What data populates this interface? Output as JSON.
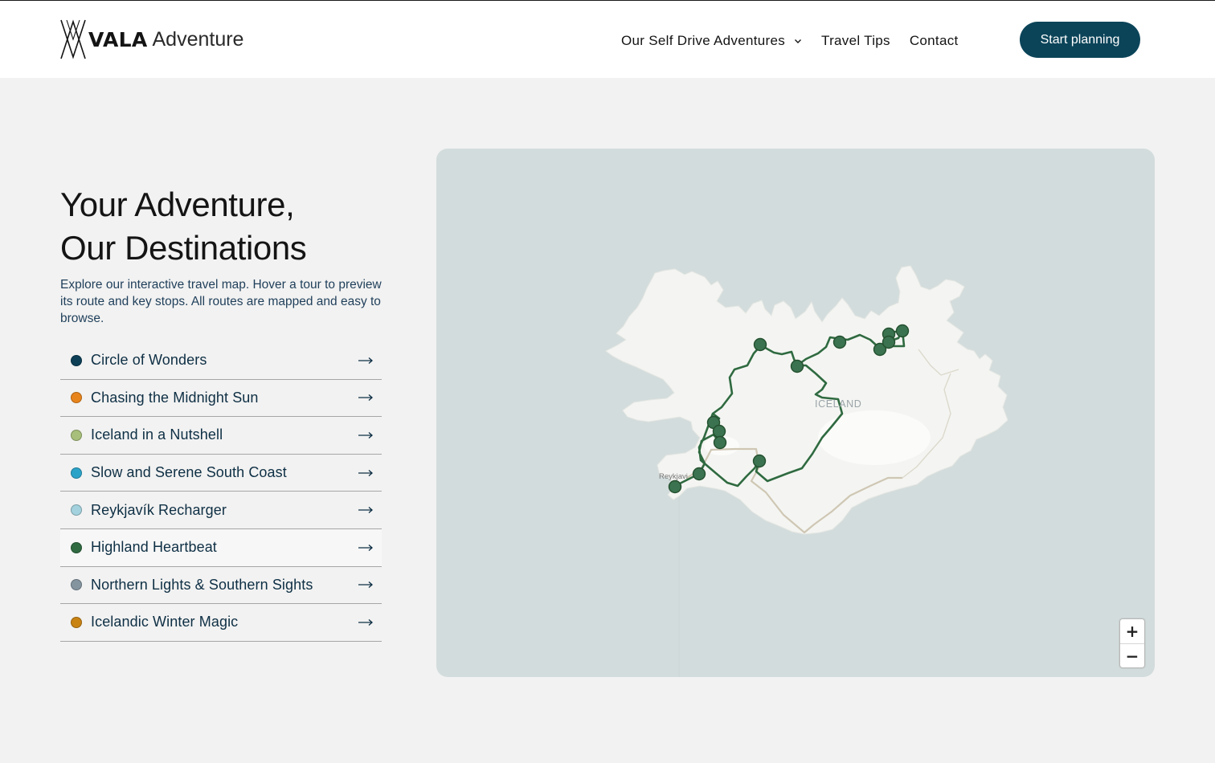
{
  "brand": {
    "name_bold": "VALA",
    "name_light": "Adventure"
  },
  "nav": {
    "items": [
      {
        "label": "Our Self Drive Adventures",
        "has_dropdown": true
      },
      {
        "label": "Travel Tips",
        "has_dropdown": false
      },
      {
        "label": "Contact",
        "has_dropdown": false
      }
    ],
    "cta_label": "Start planning"
  },
  "hero": {
    "title_line1": "Your Adventure,",
    "title_line2": "Our Destinations",
    "description": "Explore our interactive travel map. Hover a tour to preview its route and key stops. All routes are mapped and easy to browse."
  },
  "tours": [
    {
      "label": "Circle of Wonders",
      "color": "#0d3f57",
      "active": false
    },
    {
      "label": "Chasing the Midnight Sun",
      "color": "#e8841c",
      "active": false
    },
    {
      "label": "Iceland in a Nutshell",
      "color": "#a7bf7a",
      "active": false
    },
    {
      "label": "Slow and Serene South Coast",
      "color": "#2ba3c9",
      "active": false
    },
    {
      "label": "Reykjavík Recharger",
      "color": "#a3d2de",
      "active": false
    },
    {
      "label": "Highland Heartbeat",
      "color": "#2f6a40",
      "active": true
    },
    {
      "label": "Northern Lights & Southern Sights",
      "color": "#8495a0",
      "active": false
    },
    {
      "label": "Icelandic Winter Magic",
      "color": "#c98313",
      "active": false
    }
  ],
  "map": {
    "country_label": "ICELAND",
    "city_label": "Reykjavi",
    "highlighted_route_color": "#2f6a40",
    "other_route_color": "#cfc7b4",
    "zoom_in": "+",
    "zoom_out": "−"
  }
}
